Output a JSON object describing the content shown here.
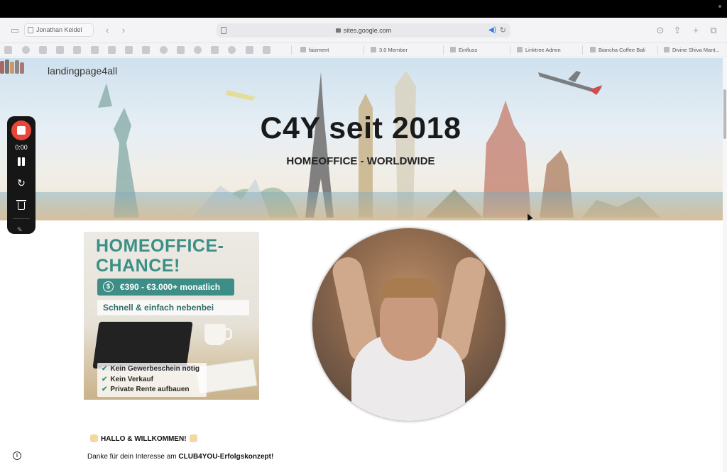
{
  "browser": {
    "profile_name": "Jonathan Keidel",
    "url": "sites.google.com",
    "bookmarks": [
      {
        "label": "faizment"
      },
      {
        "label": "3.0 Member"
      },
      {
        "label": "Einfluss"
      },
      {
        "label": "Linktree Admin"
      },
      {
        "label": "Biancha Coffee Bali"
      },
      {
        "label": "Divine Shiva Mant..."
      }
    ]
  },
  "site": {
    "name": "landingpage4all",
    "hero_title": "C4Y seit 2018",
    "hero_subtitle": "HOMEOFFICE - WORLDWIDE"
  },
  "promo": {
    "headline_line1": "HOMEOFFICE-",
    "headline_line2": "CHANCE!",
    "price": "€390 - €3.000+ monatlich",
    "price_icon": "$",
    "subline": "Schnell & einfach nebenbei",
    "checklist": [
      "Kein Gewerbeschein nötig",
      "Kein Verkauf",
      "Private Rente aufbauen"
    ]
  },
  "content": {
    "welcome": "HALLO & WILLKOMMEN!",
    "thanks_prefix": "Danke für dein Interesse am ",
    "thanks_bold": "CLUB4YOU-Erfolgskonzept!"
  },
  "recorder": {
    "time": "0:00"
  },
  "colors": {
    "accent_teal": "#3d8e86",
    "record_red": "#e8463a",
    "link_blue": "#2f7ae5"
  }
}
